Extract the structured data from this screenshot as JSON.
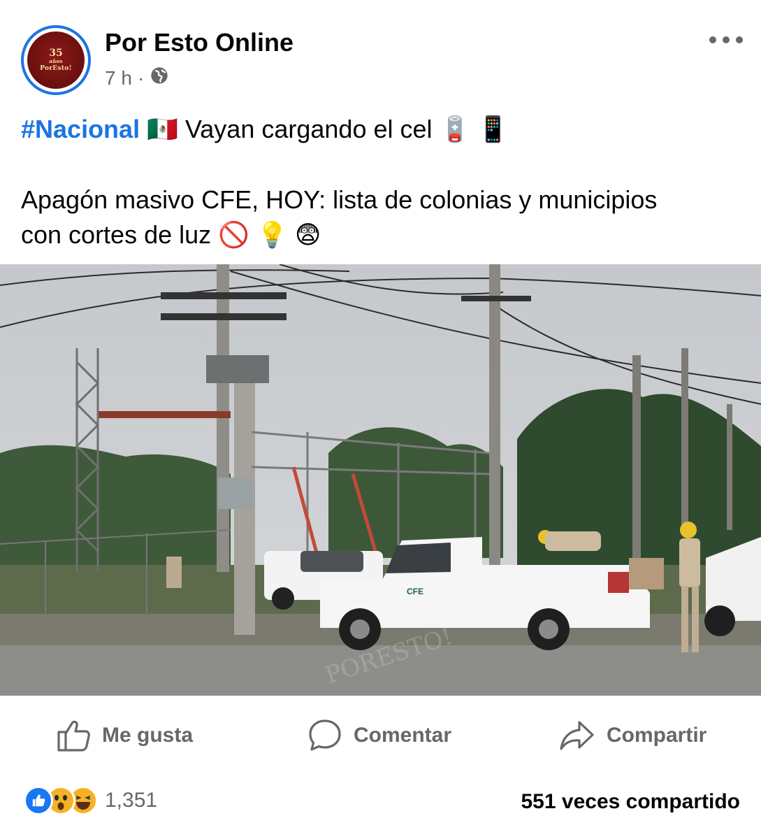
{
  "post": {
    "page_name": "Por Esto Online",
    "time": "7 h",
    "separator": "·",
    "audience_icon": "globe-icon",
    "avatar": {
      "number": "35",
      "number_suffix": "años",
      "brand": "PorEsto!"
    },
    "hashtag": "#Nacional",
    "line1_text": "Vayan cargando el cel",
    "line1_emojis": [
      "🇲🇽",
      "🪫",
      "📱"
    ],
    "line2_text": "Apagón masivo CFE, HOY: lista de colonias y municipios",
    "line3_text": "con cortes de luz",
    "line3_emojis": [
      "🚫",
      "💡",
      "😨"
    ]
  },
  "photo": {
    "truck_logo": "CFE",
    "watermark": "PORESTO!"
  },
  "actions": {
    "like_label": "Me gusta",
    "comment_label": "Comentar",
    "share_label": "Compartir"
  },
  "stats": {
    "reaction_icons": [
      "like-icon",
      "wow-icon",
      "haha-icon"
    ],
    "reaction_count": "1,351",
    "shares_text": "551 veces compartido"
  },
  "colors": {
    "accent": "#1b74e4",
    "secondary_text": "#65676b",
    "like_blue": "#1877f2",
    "reaction_yellow": "#f7b125"
  }
}
